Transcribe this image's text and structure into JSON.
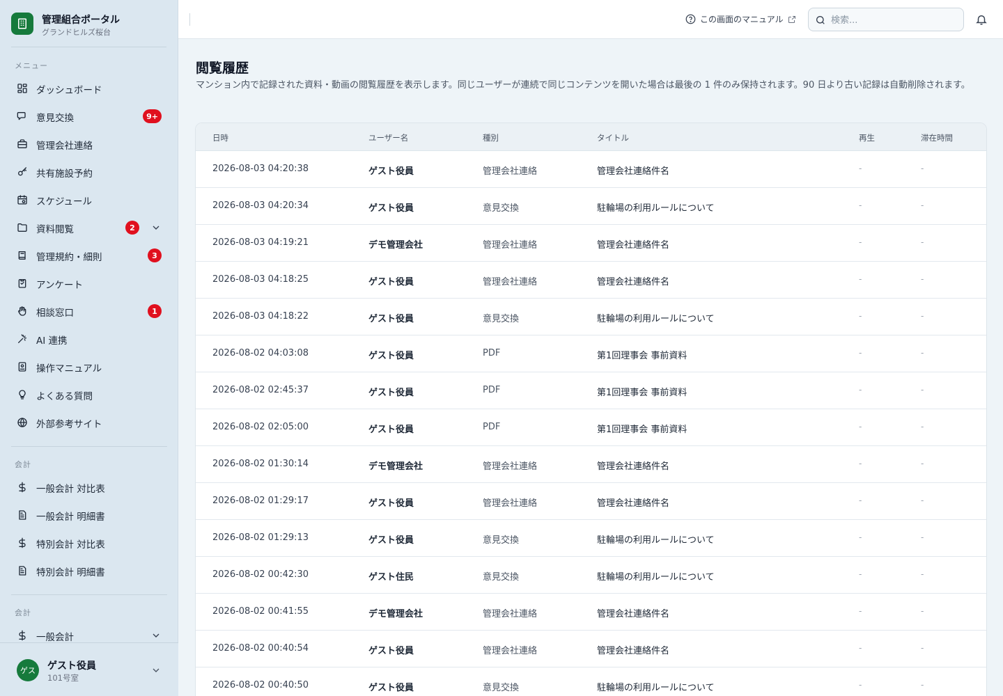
{
  "brand": {
    "title": "管理組合ポータル",
    "subtitle": "グランドヒルズ桜台"
  },
  "sidebar": {
    "menu_label": "メニュー",
    "menu": [
      {
        "label": "ダッシュボード",
        "icon": "dashboard-icon"
      },
      {
        "label": "意見交換",
        "icon": "chat-icon",
        "badge": "9+"
      },
      {
        "label": "管理会社連絡",
        "icon": "briefcase-icon"
      },
      {
        "label": "共有施設予約",
        "icon": "key-icon"
      },
      {
        "label": "スケジュール",
        "icon": "calendar-icon"
      },
      {
        "label": "資料閲覧",
        "icon": "folder-icon",
        "badge": "2",
        "expandable": true
      },
      {
        "label": "管理規約・細則",
        "icon": "book-icon",
        "badge": "3"
      },
      {
        "label": "アンケート",
        "icon": "clipboard-icon"
      },
      {
        "label": "相談窓口",
        "icon": "hand-icon",
        "badge": "1"
      },
      {
        "label": "AI 連携",
        "icon": "sparkle-icon"
      },
      {
        "label": "操作マニュアル",
        "icon": "manual-icon"
      },
      {
        "label": "よくある質問",
        "icon": "lightbulb-icon"
      },
      {
        "label": "外部参考サイト",
        "icon": "globe-icon"
      }
    ],
    "accounting_label": "会計",
    "accounting": [
      {
        "label": "一般会計 対比表",
        "icon": "dollar-icon"
      },
      {
        "label": "一般会計 明細書",
        "icon": "document-icon"
      },
      {
        "label": "特別会計 対比表",
        "icon": "dollar-icon"
      },
      {
        "label": "特別会計 明細書",
        "icon": "document-icon"
      }
    ],
    "accounting2_label": "会計",
    "accounting2": [
      {
        "label": "一般会計",
        "icon": "dollar-icon",
        "expandable": true
      }
    ],
    "user": {
      "avatar": "ゲス",
      "name": "ゲスト役員",
      "room": "101号室"
    }
  },
  "header": {
    "manual_link": "この画面のマニュアル",
    "search_placeholder": "検索..."
  },
  "page": {
    "title": "閲覧履歴",
    "description": "マンション内で記録された資料・動画の閲覧履歴を表示します。同じユーザーが連続で同じコンテンツを開いた場合は最後の 1 件のみ保持されます。90 日より古い記録は自動削除されます。"
  },
  "table": {
    "columns": [
      "日時",
      "ユーザー名",
      "種別",
      "タイトル",
      "再生",
      "滞在時間"
    ],
    "rows": [
      {
        "datetime": "2026-08-03 04:20:38",
        "user": "ゲスト役員",
        "kind": "管理会社連絡",
        "title": "管理会社連絡件名",
        "play": "-",
        "duration": "-"
      },
      {
        "datetime": "2026-08-03 04:20:34",
        "user": "ゲスト役員",
        "kind": "意見交換",
        "title": "駐輪場の利用ルールについて",
        "play": "-",
        "duration": "-"
      },
      {
        "datetime": "2026-08-03 04:19:21",
        "user": "デモ管理会社",
        "kind": "管理会社連絡",
        "title": "管理会社連絡件名",
        "play": "-",
        "duration": "-"
      },
      {
        "datetime": "2026-08-03 04:18:25",
        "user": "ゲスト役員",
        "kind": "管理会社連絡",
        "title": "管理会社連絡件名",
        "play": "-",
        "duration": "-"
      },
      {
        "datetime": "2026-08-03 04:18:22",
        "user": "ゲスト役員",
        "kind": "意見交換",
        "title": "駐輪場の利用ルールについて",
        "play": "-",
        "duration": "-"
      },
      {
        "datetime": "2026-08-02 04:03:08",
        "user": "ゲスト役員",
        "kind": "PDF",
        "title": "第1回理事会 事前資料",
        "play": "-",
        "duration": "-"
      },
      {
        "datetime": "2026-08-02 02:45:37",
        "user": "ゲスト役員",
        "kind": "PDF",
        "title": "第1回理事会 事前資料",
        "play": "-",
        "duration": "-"
      },
      {
        "datetime": "2026-08-02 02:05:00",
        "user": "ゲスト役員",
        "kind": "PDF",
        "title": "第1回理事会 事前資料",
        "play": "-",
        "duration": "-"
      },
      {
        "datetime": "2026-08-02 01:30:14",
        "user": "デモ管理会社",
        "kind": "管理会社連絡",
        "title": "管理会社連絡件名",
        "play": "-",
        "duration": "-"
      },
      {
        "datetime": "2026-08-02 01:29:17",
        "user": "ゲスト役員",
        "kind": "管理会社連絡",
        "title": "管理会社連絡件名",
        "play": "-",
        "duration": "-"
      },
      {
        "datetime": "2026-08-02 01:29:13",
        "user": "ゲスト役員",
        "kind": "意見交換",
        "title": "駐輪場の利用ルールについて",
        "play": "-",
        "duration": "-"
      },
      {
        "datetime": "2026-08-02 00:42:30",
        "user": "ゲスト住民",
        "kind": "意見交換",
        "title": "駐輪場の利用ルールについて",
        "play": "-",
        "duration": "-"
      },
      {
        "datetime": "2026-08-02 00:41:55",
        "user": "デモ管理会社",
        "kind": "管理会社連絡",
        "title": "管理会社連絡件名",
        "play": "-",
        "duration": "-"
      },
      {
        "datetime": "2026-08-02 00:40:54",
        "user": "ゲスト役員",
        "kind": "管理会社連絡",
        "title": "管理会社連絡件名",
        "play": "-",
        "duration": "-"
      },
      {
        "datetime": "2026-08-02 00:40:50",
        "user": "ゲスト役員",
        "kind": "意見交換",
        "title": "駐輪場の利用ルールについて",
        "play": "-",
        "duration": "-"
      }
    ]
  },
  "colors": {
    "brand": "#167a3c",
    "badge": "#e0101e",
    "sidebar_bg": "#dbe7f0",
    "page_bg": "#eef4f8"
  }
}
